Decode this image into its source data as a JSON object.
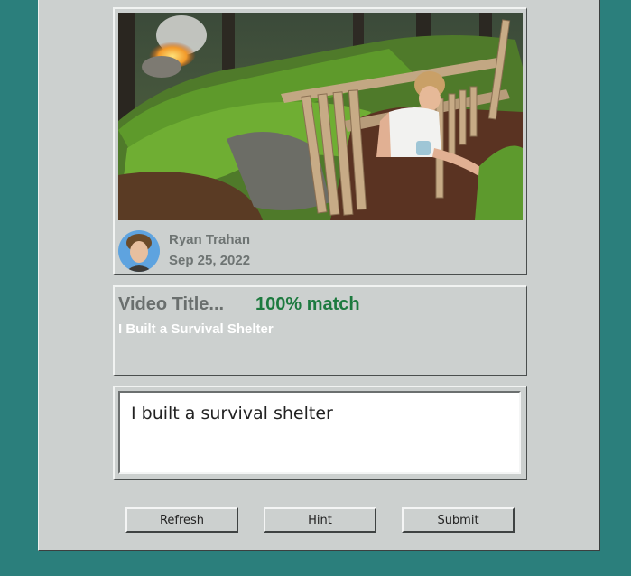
{
  "video": {
    "channel": "Ryan Trahan",
    "date": "Sep 25, 2022",
    "thumbnail_icon": "survival-shelter-thumbnail",
    "avatar_icon": "channel-avatar"
  },
  "result": {
    "label": "Video Title...",
    "match": "100% match",
    "answer": "I Built a Survival Shelter"
  },
  "guess": {
    "value": "I built a survival shelter"
  },
  "buttons": {
    "refresh": "Refresh",
    "hint": "Hint",
    "submit": "Submit"
  },
  "colors": {
    "background": "#2b7f7c",
    "panel": "#ccd0cf",
    "match": "#1d7a3f"
  }
}
